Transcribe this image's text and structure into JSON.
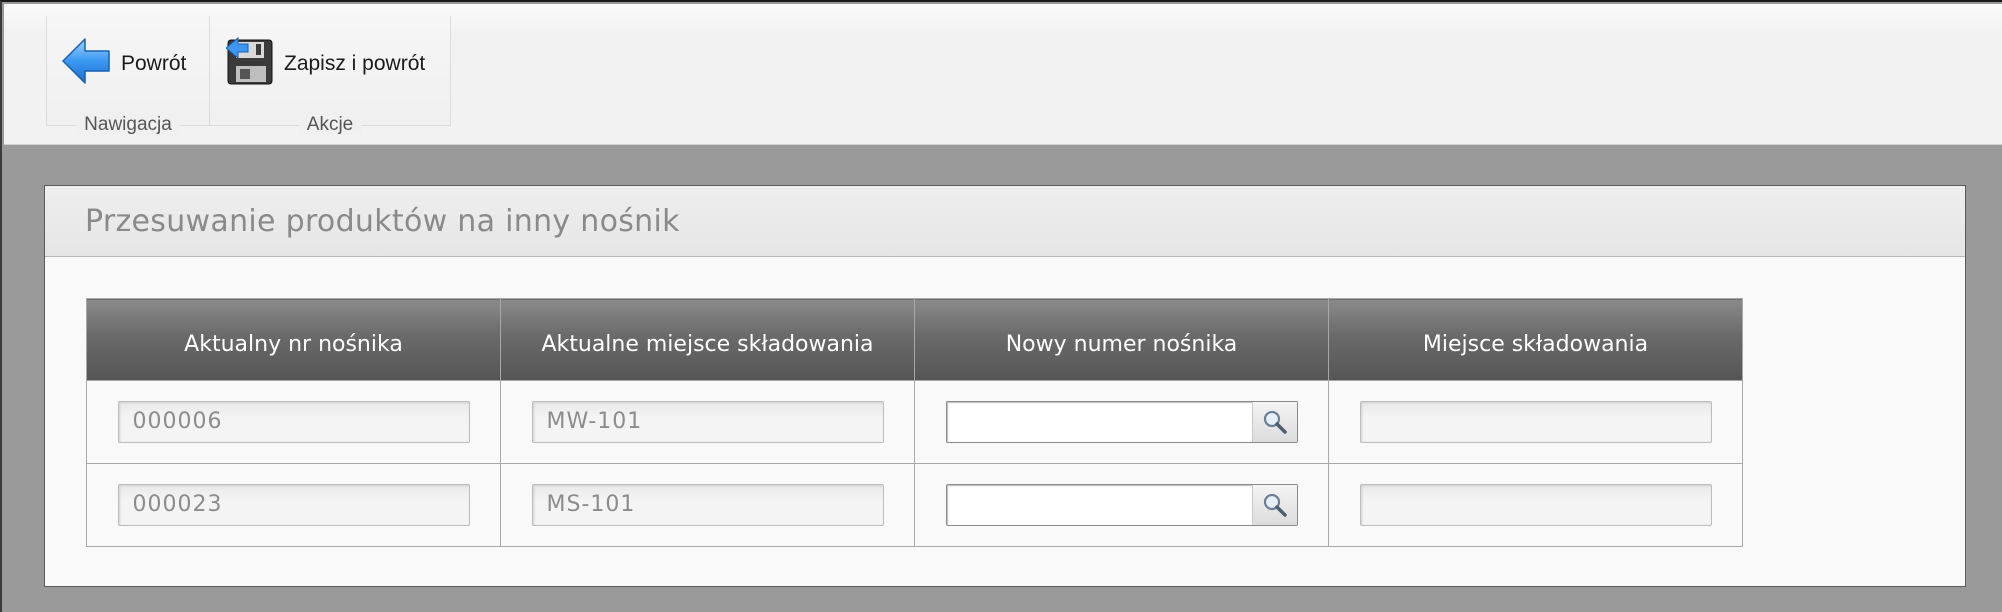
{
  "toolbar": {
    "navigation": {
      "group_label": "Nawigacja",
      "back_label": "Powrót"
    },
    "actions": {
      "group_label": "Akcje",
      "save_back_label": "Zapisz i powrót"
    }
  },
  "panel": {
    "title": "Przesuwanie produktów na inny nośnik"
  },
  "table": {
    "headers": {
      "current_carrier": "Aktualny nr nośnika",
      "current_location": "Aktualne miejsce składowania",
      "new_carrier": "Nowy numer nośnika",
      "location": "Miejsce składowania"
    },
    "rows": [
      {
        "current_carrier": "000006",
        "current_location": "MW-101",
        "new_carrier": "",
        "location": ""
      },
      {
        "current_carrier": "000023",
        "current_location": "MS-101",
        "new_carrier": "",
        "location": ""
      }
    ]
  },
  "icons": {
    "back": "arrow-left-icon",
    "save": "floppy-disk-icon",
    "lookup": "magnifier-icon"
  },
  "colors": {
    "header_bg": "#5e5e5e",
    "page_bg": "#9a9a9a",
    "accent_arrow": "#2e8ff0"
  }
}
